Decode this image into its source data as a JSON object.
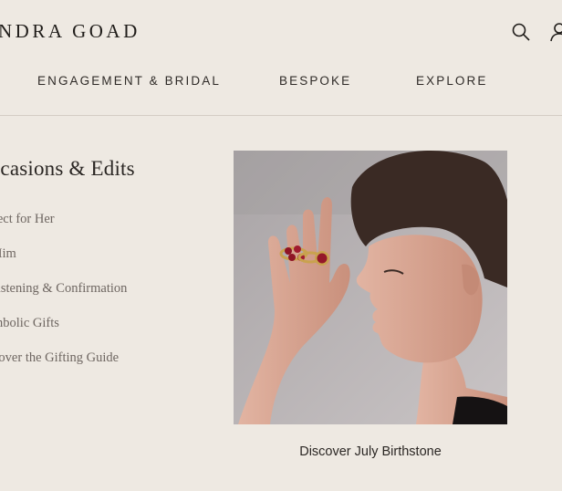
{
  "header": {
    "brand": "NDRA GOAD",
    "search_icon": "search-icon",
    "account_icon": "user-icon"
  },
  "nav": {
    "items": [
      {
        "label": "ENGAGEMENT & BRIDAL"
      },
      {
        "label": "BESPOKE"
      },
      {
        "label": "EXPLORE"
      }
    ]
  },
  "menu": {
    "title": "ccasions & Edits",
    "links": [
      {
        "label": "fect for Her"
      },
      {
        "label": "Him"
      },
      {
        "label": "ristening & Confirmation"
      },
      {
        "label": "mbolic Gifts"
      },
      {
        "label": "cover the Gifting Guide"
      }
    ]
  },
  "feature": {
    "caption": "Discover July Birthstone"
  },
  "colors": {
    "background": "#eee9e2",
    "text": "#2b2724",
    "muted_text": "#6e6661",
    "divider": "#d4cdc4"
  }
}
